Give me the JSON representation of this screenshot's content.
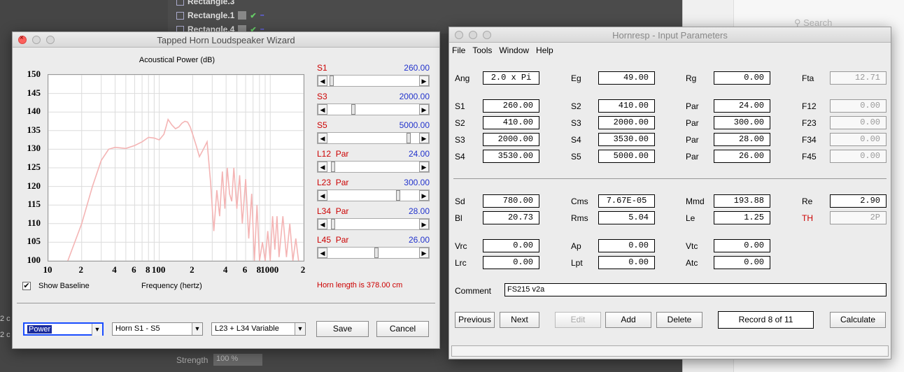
{
  "background": {
    "layers": [
      "Rectangle.3",
      "Rectangle.1",
      "Rectangle.4"
    ],
    "search_placeholder": "Search",
    "strength_label": "Strength",
    "strength_value": "100 %",
    "left_labels": [
      "2 c",
      "2 c"
    ]
  },
  "wizard": {
    "title": "Tapped Horn Loudspeaker Wizard",
    "chart_title": "Acoustical Power (dB)",
    "xlabel": "Frequency (hertz)",
    "show_baseline_label": "Show Baseline",
    "show_baseline_checked": true,
    "sliders": [
      {
        "label": "S1",
        "par": "",
        "value": "260.00",
        "pos": 0.02
      },
      {
        "label": "S3",
        "par": "",
        "value": "2000.00",
        "pos": 0.27
      },
      {
        "label": "S5",
        "par": "",
        "value": "5000.00",
        "pos": 0.89
      },
      {
        "label": "L12",
        "par": "Par",
        "value": "24.00",
        "pos": 0.04
      },
      {
        "label": "L23",
        "par": "Par",
        "value": "300.00",
        "pos": 0.77
      },
      {
        "label": "L34",
        "par": "Par",
        "value": "28.00",
        "pos": 0.04
      },
      {
        "label": "L45",
        "par": "Par",
        "value": "26.00",
        "pos": 0.53
      }
    ],
    "horn_length": "Horn length is 378.00 cm",
    "select_plot": "Power",
    "select_horn": "Horn S1 - S5",
    "select_variable": "L23 + L34 Variable",
    "save_label": "Save",
    "cancel_label": "Cancel"
  },
  "chart_data": {
    "type": "line",
    "title": "Acoustical Power (dB)",
    "xlabel": "Frequency (hertz)",
    "ylabel": "",
    "xscale": "log",
    "xlim": [
      10,
      2000
    ],
    "ylim": [
      100,
      150
    ],
    "yticks": [
      "150",
      "145",
      "140",
      "135",
      "130",
      "125",
      "120",
      "115",
      "110",
      "105",
      "100"
    ],
    "xticks": [
      {
        "v": 10,
        "t": "10"
      },
      {
        "v": 20,
        "t": "2"
      },
      {
        "v": 40,
        "t": "4"
      },
      {
        "v": 60,
        "t": "6"
      },
      {
        "v": 80,
        "t": "8"
      },
      {
        "v": 100,
        "t": "100"
      },
      {
        "v": 200,
        "t": "2"
      },
      {
        "v": 400,
        "t": "4"
      },
      {
        "v": 600,
        "t": "6"
      },
      {
        "v": 800,
        "t": "8"
      },
      {
        "v": 1000,
        "t": "1000"
      },
      {
        "v": 2000,
        "t": "2"
      }
    ],
    "grid": true,
    "line_color": "#f4b4b4",
    "series": [
      {
        "x": [
          15,
          20,
          25,
          30,
          35,
          40,
          50,
          60,
          70,
          80,
          90,
          100,
          110,
          115,
          120,
          130,
          140,
          150,
          160,
          170,
          180,
          190,
          200,
          215,
          230,
          250,
          270,
          290,
          310,
          330,
          350,
          370,
          390,
          410,
          430,
          450,
          470,
          500,
          530,
          560,
          600,
          640,
          680,
          720,
          760,
          800,
          850,
          900,
          950,
          1000,
          1050,
          1100,
          1150,
          1200,
          1300,
          1400,
          1500,
          1600,
          1700,
          1800
        ],
        "y": [
          100,
          110,
          120,
          127,
          130,
          130.5,
          130.2,
          131,
          132,
          133.2,
          133,
          132.5,
          134,
          136,
          138,
          136.5,
          135.5,
          136,
          137,
          137.5,
          137.3,
          136,
          134,
          131,
          128,
          130,
          132,
          121,
          108,
          119,
          112,
          124,
          114,
          125,
          118,
          116,
          125,
          114,
          123,
          110,
          122,
          106,
          118,
          100,
          115,
          100,
          105,
          100,
          108,
          100,
          112,
          103,
          112,
          101,
          112,
          101,
          110,
          100,
          106,
          100
        ]
      }
    ]
  },
  "hornresp": {
    "title": "Hornresp - Input Parameters",
    "menu": [
      "File",
      "Tools",
      "Window",
      "Help"
    ],
    "fields": {
      "ang_label": "Ang",
      "ang": "2.0 x Pi",
      "eg_label": "Eg",
      "eg": "49.00",
      "rg_label": "Rg",
      "rg": "0.00",
      "fta_label": "Fta",
      "fta": "12.71",
      "rows": [
        {
          "l1": "S1",
          "v1": "260.00",
          "l2": "S2",
          "v2": "410.00",
          "l3": "Par",
          "v3": "24.00",
          "l4": "F12",
          "v4": "0.00"
        },
        {
          "l1": "S2",
          "v1": "410.00",
          "l2": "S3",
          "v2": "2000.00",
          "l3": "Par",
          "v3": "300.00",
          "l4": "F23",
          "v4": "0.00"
        },
        {
          "l1": "S3",
          "v1": "2000.00",
          "l2": "S4",
          "v2": "3530.00",
          "l3": "Par",
          "v3": "28.00",
          "l4": "F34",
          "v4": "0.00"
        },
        {
          "l1": "S4",
          "v1": "3530.00",
          "l2": "S5",
          "v2": "5000.00",
          "l3": "Par",
          "v3": "26.00",
          "l4": "F45",
          "v4": "0.00"
        }
      ],
      "sd_label": "Sd",
      "sd": "780.00",
      "cms_label": "Cms",
      "cms": "7.67E-05",
      "mmd_label": "Mmd",
      "mmd": "193.88",
      "re_label": "Re",
      "re": "2.90",
      "bl_label": "Bl",
      "bl": "20.73",
      "rms_label": "Rms",
      "rms": "5.04",
      "le_label": "Le",
      "le": "1.25",
      "th_label": "TH",
      "th": "2P",
      "vrc_label": "Vrc",
      "vrc": "0.00",
      "ap_label": "Ap",
      "ap": "0.00",
      "vtc_label": "Vtc",
      "vtc": "0.00",
      "lrc_label": "Lrc",
      "lrc": "0.00",
      "lpt_label": "Lpt",
      "lpt": "0.00",
      "atc_label": "Atc",
      "atc": "0.00"
    },
    "comment_label": "Comment",
    "comment": "FS215 v2a",
    "buttons": {
      "previous": "Previous",
      "next": "Next",
      "edit": "Edit",
      "add": "Add",
      "delete": "Delete",
      "calculate": "Calculate"
    },
    "record": "Record 8 of 11"
  },
  "colors": {
    "accent": "#1a4dff",
    "label_red": "#cc0000",
    "value_blue": "#2233cc"
  }
}
